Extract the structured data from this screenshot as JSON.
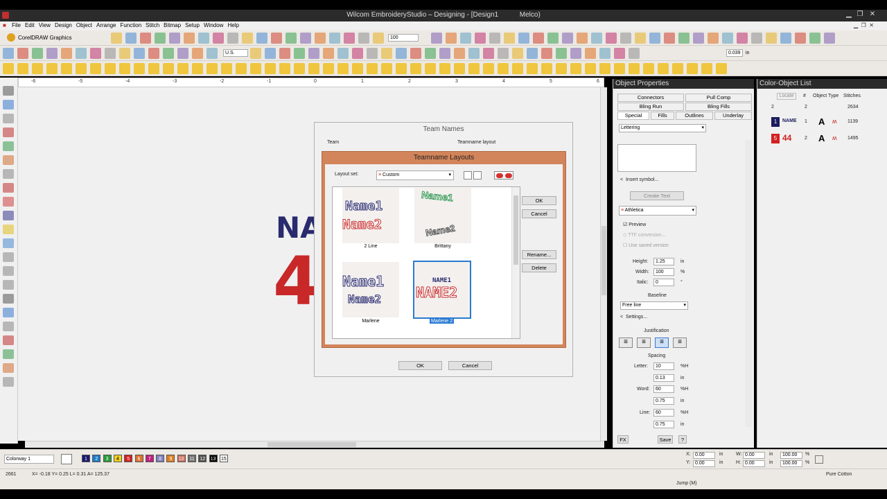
{
  "app": {
    "title": "Wilcom EmbroideryStudio – Designing - [Design1",
    "title_right": "Melco)"
  },
  "menu": [
    "File",
    "Edit",
    "View",
    "Design",
    "Object",
    "Arrange",
    "Function",
    "Stitch",
    "Bitmap",
    "Setup",
    "Window",
    "Help"
  ],
  "toolbar": {
    "corel_label": "CorelDRAW Graphics",
    "zoom_value": "100",
    "units_value": "U.S.",
    "value_0": "0",
    "value_0b": "0",
    "value_0c": "0",
    "stitch_value": "0.039",
    "in_label": "in"
  },
  "ruler": {
    "h_ticks": [
      "-6",
      "-5",
      "-4",
      "-3",
      "-2",
      "-1",
      "0",
      "1",
      "2",
      "3",
      "4",
      "5",
      "6"
    ]
  },
  "canvas": {
    "text_top": "NA",
    "text_bottom": "4"
  },
  "team_names": {
    "title": "Team Names",
    "team_label": "Team",
    "layout_label": "Teamname layout",
    "ok": "OK",
    "cancel": "Cancel"
  },
  "layouts": {
    "title": "Teamname Layouts",
    "layout_set_label": "Layout set:",
    "layout_set_value": "Custom",
    "items": [
      {
        "line1": "Name1",
        "line2": "Name2",
        "caption": "2 Line"
      },
      {
        "line1": "Name1",
        "line2": "Name2",
        "caption": "Brittany"
      },
      {
        "line1": "Name1",
        "line2": "Name2",
        "caption": "Marlene"
      },
      {
        "line1": "NAME1",
        "line2": "NAME2",
        "caption": "Marlene 2"
      }
    ],
    "ok": "OK",
    "cancel": "Cancel",
    "rename": "Rename...",
    "delete": "Delete"
  },
  "object_properties": {
    "title": "Object Properties",
    "tabs_row1": [
      "Connectors",
      "Pull Comp"
    ],
    "tabs_row2": [
      "Bling Run",
      "Bling Fills"
    ],
    "tabs_row3": [
      "Special",
      "Fills",
      "Outlines",
      "Underlay"
    ],
    "object_type": "Lettering",
    "insert_symbol": "Insert symbol...",
    "create_text": "Create Text",
    "font": "Athletica",
    "preview": "Preview",
    "ttf_conversion": "TTF conversion...",
    "use_saved": "Use saved version",
    "height_label": "Height:",
    "height": "1.25",
    "height_unit": "in",
    "width_label": "Width:",
    "width": "100",
    "width_unit": "%",
    "italic_label": "Italic:",
    "italic": "0",
    "italic_unit": "°",
    "baseline_label": "Baseline",
    "baseline_value": "Free line",
    "settings": "Settings...",
    "justification_label": "Justification",
    "spacing_label": "Spacing",
    "letter_label": "Letter:",
    "letter": "10",
    "letter_unit": "%H",
    "letter_in": "0.13",
    "letter_in_unit": "in",
    "word_label": "Word:",
    "word": "60",
    "word_unit": "%H",
    "word_in": "0.75",
    "word_in_unit": "in",
    "line_label": "Line:",
    "line": "60",
    "line_unit": "%H",
    "line_in": "0.75",
    "line_in_unit": "in",
    "fx": "FX",
    "save": "Save",
    "help": "?"
  },
  "color_object_list": {
    "title": "Color-Object List",
    "locate": "Locate",
    "headers": [
      "#",
      "Object Type",
      "Stitches"
    ],
    "summary": {
      "a": "2",
      "b": "2",
      "stitches": "2634"
    },
    "rows": [
      {
        "num": "1",
        "color": "#1a1a5e",
        "thumb": "NAME",
        "count": "1",
        "stitches": "1139"
      },
      {
        "num": "5",
        "color": "#d42020",
        "thumb": "44",
        "count": "2",
        "stitches": "1495"
      }
    ]
  },
  "colorway": {
    "name": "Colorway 1",
    "swatches": [
      {
        "n": "1",
        "c": "#1a1a6e"
      },
      {
        "n": "2",
        "c": "#1e7bc8"
      },
      {
        "n": "3",
        "c": "#2a9a3a"
      },
      {
        "n": "4",
        "c": "#f0d020"
      },
      {
        "n": "5",
        "c": "#d42020"
      },
      {
        "n": "6",
        "c": "#e07030"
      },
      {
        "n": "7",
        "c": "#c02080"
      },
      {
        "n": "8",
        "c": "#8080c0"
      },
      {
        "n": "9",
        "c": "#e08020"
      },
      {
        "n": "10",
        "c": "#d07060"
      },
      {
        "n": "11",
        "c": "#707070"
      },
      {
        "n": "12",
        "c": "#505050"
      },
      {
        "n": "13",
        "c": "#000000"
      },
      {
        "n": "15",
        "c": "#ffffff"
      }
    ]
  },
  "coords": {
    "x_label": "X:",
    "x": "0.00",
    "y_label": "Y:",
    "y": "0.00",
    "w_label": "W:",
    "w": "0.00",
    "h_label": "H:",
    "h": "0.00",
    "wp": "100.00",
    "hp": "100.00",
    "unit": "in",
    "pct": "%"
  },
  "status": {
    "count": "2661",
    "xy": "X=  -0.18 Y=   0.25 L=   0.31 A= 125.37",
    "mode": "Jump (M)",
    "fabric": "Pure Cotton"
  }
}
